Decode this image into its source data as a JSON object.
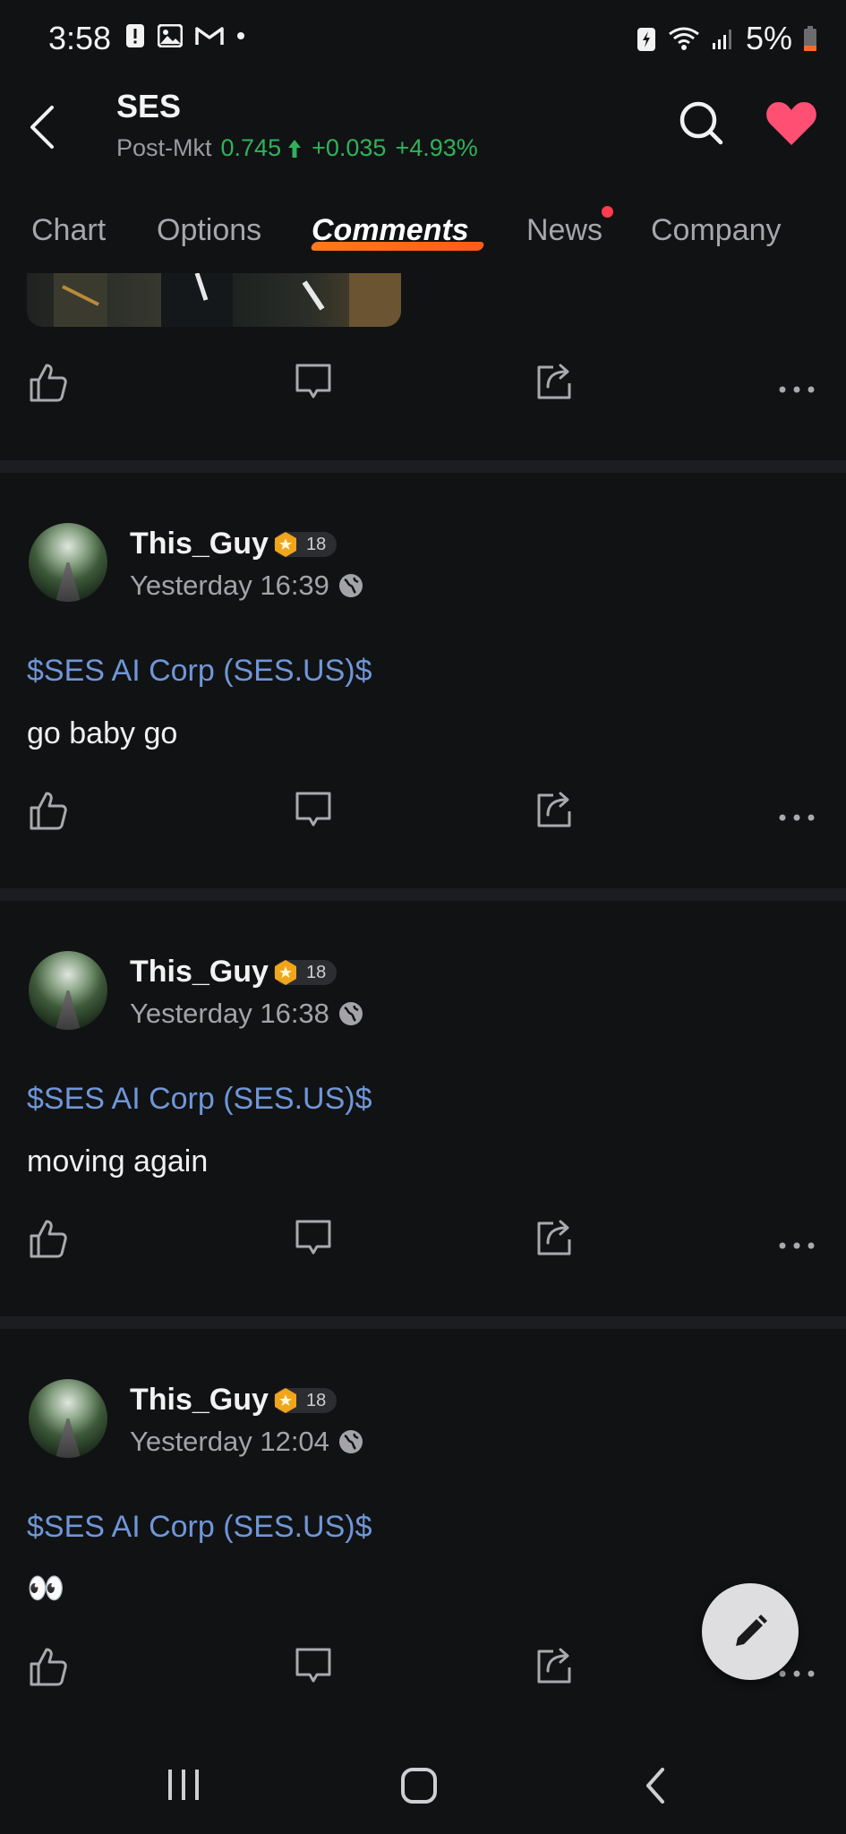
{
  "status_bar": {
    "time": "3:58",
    "battery": "5%",
    "icons": [
      "alert-icon",
      "image-icon",
      "gmail-icon",
      "dot-icon",
      "battery-saver-icon",
      "wifi-icon",
      "signal-icon",
      "battery-icon"
    ]
  },
  "header": {
    "ticker": "SES",
    "quote_label": "Post-Mkt",
    "price": "0.745",
    "change": "+0.035",
    "change_pct": "+4.93%",
    "colors": {
      "up": "#2fb25a",
      "favorite": "#ff4f73"
    }
  },
  "tabs": [
    {
      "label": "Chart"
    },
    {
      "label": "Options"
    },
    {
      "label": "Comments",
      "active": true
    },
    {
      "label": "News",
      "notification_dot": true
    },
    {
      "label": "Company"
    }
  ],
  "posts": [
    {
      "username": "This_Guy",
      "level": "18",
      "timestamp": "Yesterday 16:39",
      "stock_link": "$SES AI Corp (SES.US)$",
      "text": "go baby go"
    },
    {
      "username": "This_Guy",
      "level": "18",
      "timestamp": "Yesterday 16:38",
      "stock_link": "$SES AI Corp (SES.US)$",
      "text": "moving again"
    },
    {
      "username": "This_Guy",
      "level": "18",
      "timestamp": "Yesterday 12:04",
      "stock_link": "$SES AI Corp (SES.US)$",
      "text": "👀"
    }
  ],
  "colors": {
    "background": "#111214",
    "link": "#6f97d8",
    "tab_underline": "#ff6a1a"
  }
}
